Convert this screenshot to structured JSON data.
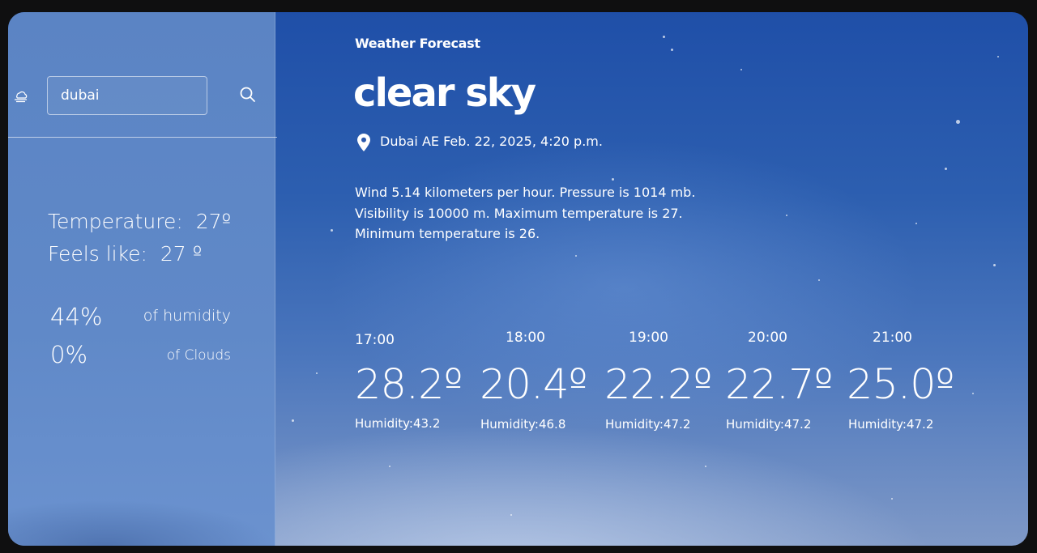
{
  "search": {
    "value": "dubai",
    "placeholder": ""
  },
  "icons": {
    "app": "cloud-icon",
    "search": "search-icon",
    "location": "location-pin-icon"
  },
  "current": {
    "temperature_label": "Temperature:",
    "temperature_value": "27º",
    "feels_like_label": "Feels like:",
    "feels_like_value": "27 º",
    "humidity_value": "44%",
    "humidity_label": "of humidity",
    "clouds_value": "0%",
    "clouds_label": "of Clouds"
  },
  "header": {
    "subtitle": "Weather Forecast",
    "condition": "clear sky"
  },
  "location": {
    "text": "Dubai AE Feb. 22, 2025, 4:20 p.m."
  },
  "description": "Wind 5.14 kilometers per hour. Pressure is 1014 mb. Visibility is 10000 m. Maximum temperature is 27. Minimum temperature is 26.",
  "forecast": [
    {
      "time": "17:00",
      "temp": "28.2º",
      "humidity": "Humidity:43.2"
    },
    {
      "time": "18:00",
      "temp": "20.4º",
      "humidity": "Humidity:46.8"
    },
    {
      "time": "19:00",
      "temp": "22.2º",
      "humidity": "Humidity:47.2"
    },
    {
      "time": "20:00",
      "temp": "22.7º",
      "humidity": "Humidity:47.2"
    },
    {
      "time": "21:00",
      "temp": "25.0º",
      "humidity": "Humidity:47.2"
    }
  ],
  "colors": {
    "background": "#1f4fa8",
    "sidebar": "#5b84c4",
    "text": "#ffffff"
  }
}
